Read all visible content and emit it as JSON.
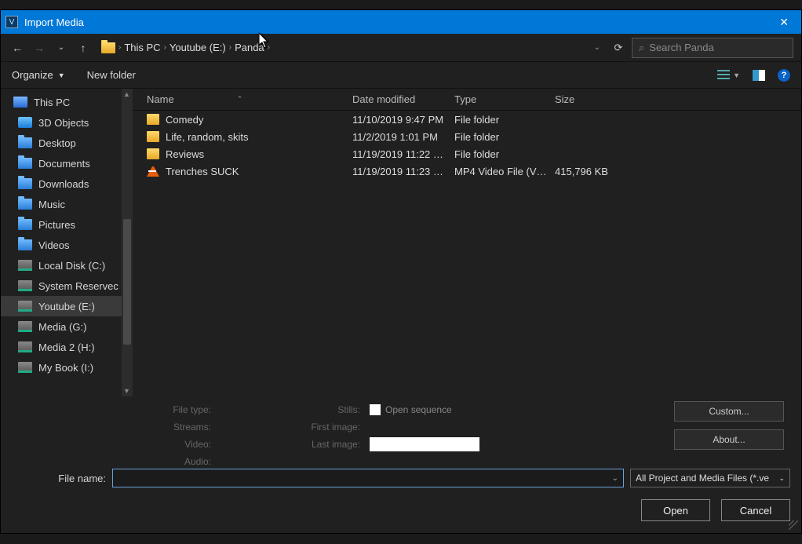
{
  "titlebar": {
    "title": "Import Media",
    "icon_letter": "V"
  },
  "nav": {
    "crumbs": [
      "This PC",
      "Youtube (E:)",
      "Panda"
    ],
    "search_placeholder": "Search Panda"
  },
  "toolbar": {
    "organize": "Organize",
    "new_folder": "New folder"
  },
  "sidebar": {
    "items": [
      {
        "label": "This PC",
        "icon": "pc",
        "lv": 0
      },
      {
        "label": "3D Objects",
        "icon": "obj",
        "lv": 1
      },
      {
        "label": "Desktop",
        "icon": "folder-blue",
        "lv": 1
      },
      {
        "label": "Documents",
        "icon": "folder-blue",
        "lv": 1
      },
      {
        "label": "Downloads",
        "icon": "folder-blue",
        "lv": 1
      },
      {
        "label": "Music",
        "icon": "folder-blue",
        "lv": 1
      },
      {
        "label": "Pictures",
        "icon": "folder-blue",
        "lv": 1
      },
      {
        "label": "Videos",
        "icon": "folder-blue",
        "lv": 1
      },
      {
        "label": "Local Disk (C:)",
        "icon": "disk",
        "lv": 1
      },
      {
        "label": "System Reservec",
        "icon": "disk",
        "lv": 1
      },
      {
        "label": "Youtube (E:)",
        "icon": "disk",
        "lv": 1,
        "selected": true
      },
      {
        "label": "Media (G:)",
        "icon": "disk",
        "lv": 1
      },
      {
        "label": "Media 2 (H:)",
        "icon": "disk",
        "lv": 1
      },
      {
        "label": "My Book (I:)",
        "icon": "disk",
        "lv": 1
      }
    ]
  },
  "columns": {
    "name": "Name",
    "date": "Date modified",
    "type": "Type",
    "size": "Size"
  },
  "files": [
    {
      "name": "Comedy",
      "date": "11/10/2019 9:47 PM",
      "type": "File folder",
      "size": "",
      "icon": "folder"
    },
    {
      "name": "Life, random, skits",
      "date": "11/2/2019 1:01 PM",
      "type": "File folder",
      "size": "",
      "icon": "folder"
    },
    {
      "name": "Reviews",
      "date": "11/19/2019 11:22 …",
      "type": "File folder",
      "size": "",
      "icon": "folder"
    },
    {
      "name": "Trenches SUCK",
      "date": "11/19/2019 11:23 …",
      "type": "MP4 Video File (V…",
      "size": "415,796 KB",
      "icon": "vlc"
    }
  ],
  "meta": {
    "file_type": "File type:",
    "streams": "Streams:",
    "video": "Video:",
    "audio": "Audio:",
    "stills": "Stills:",
    "open_sequence": "Open sequence",
    "first_image": "First image:",
    "last_image": "Last image:",
    "custom": "Custom...",
    "about": "About..."
  },
  "bottom": {
    "file_name_label": "File name:",
    "filter": "All Project and Media Files (*.ve",
    "open": "Open",
    "cancel": "Cancel"
  }
}
